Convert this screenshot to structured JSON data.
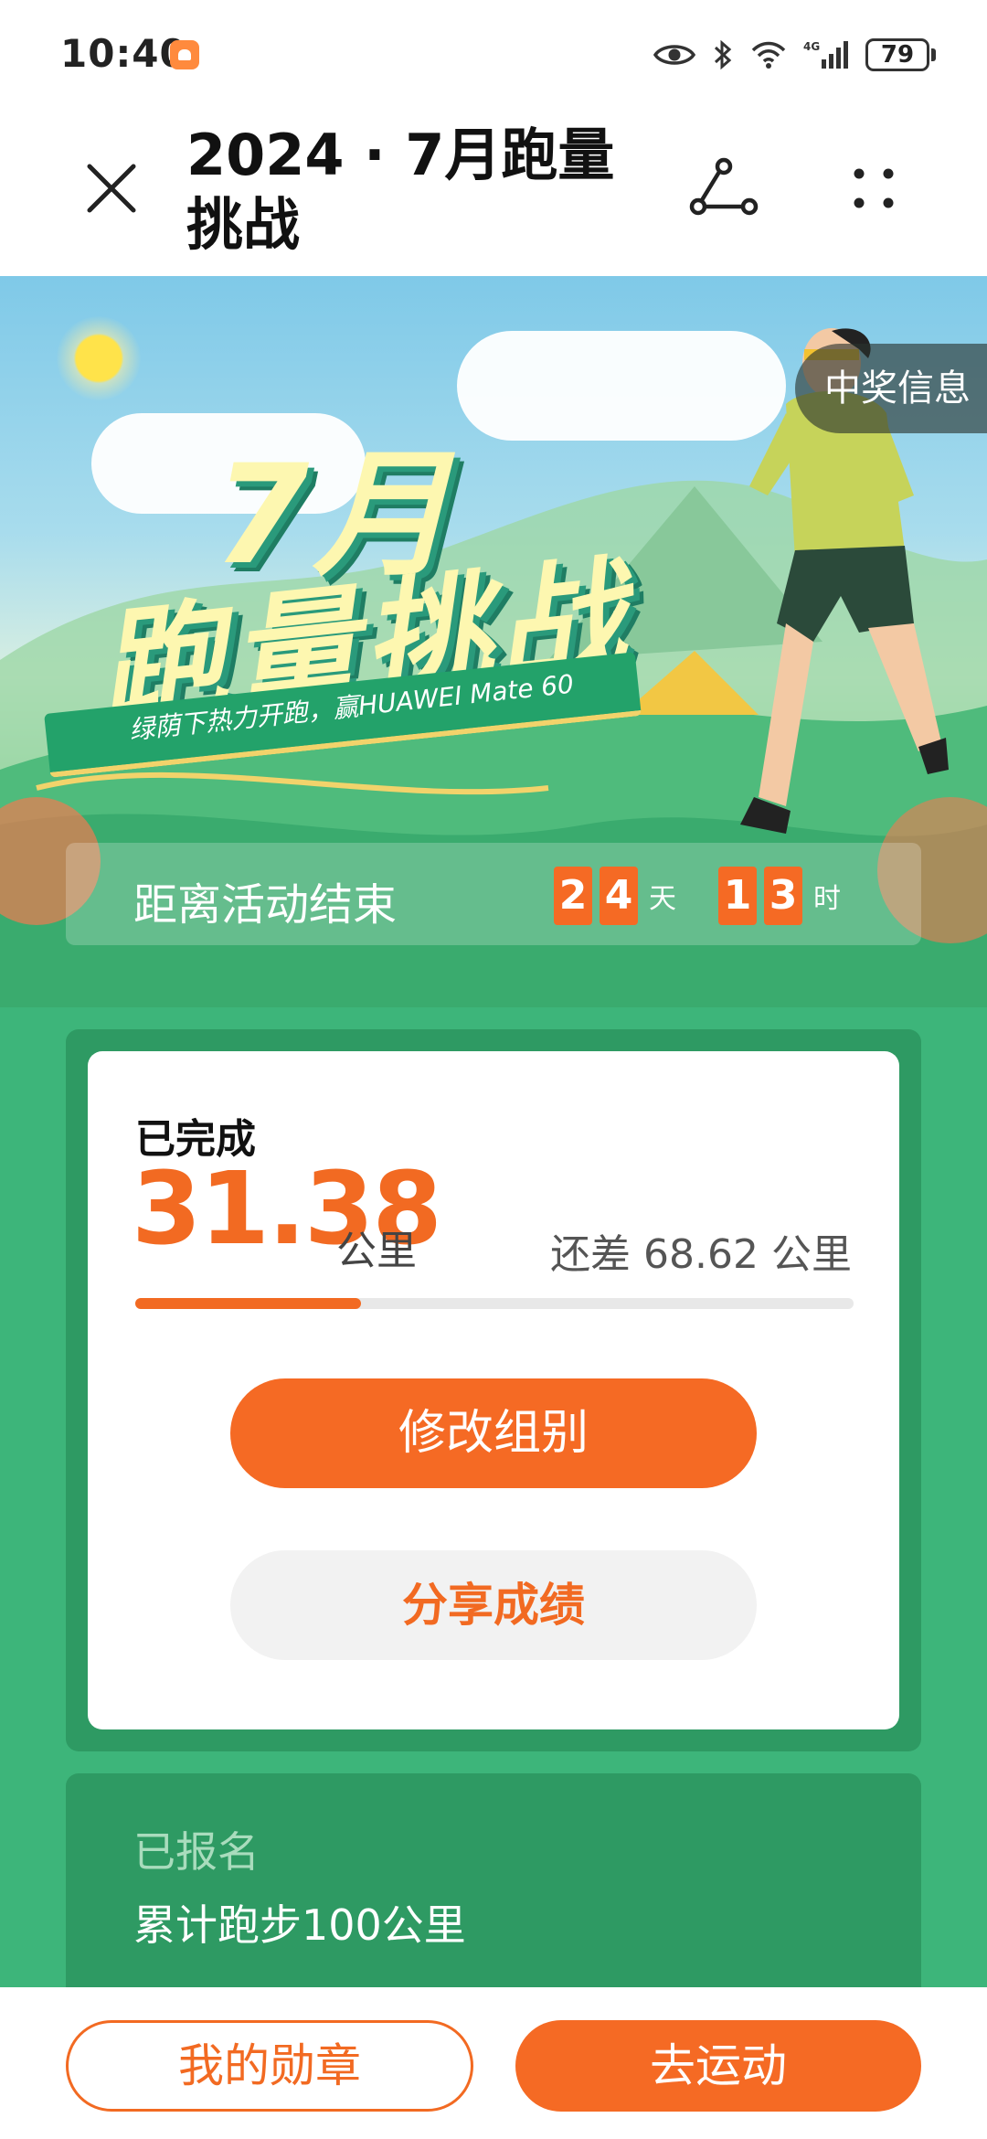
{
  "status_bar": {
    "time": "10:40",
    "battery": "79",
    "icons": [
      "app-icon",
      "eye-icon",
      "bluetooth-icon",
      "wifi-icon",
      "4g-signal-icon",
      "battery-icon"
    ]
  },
  "header": {
    "title": "2024 · 7月跑量挑战",
    "close_icon": "close-icon",
    "share_icon": "share-icon",
    "more_icon": "more-icon"
  },
  "banner": {
    "title_line1": "7月",
    "title_line2": "跑量挑战",
    "subtitle": "绿荫下热力开跑，赢HUAWEI Mate 60",
    "prize_info": "中奖信息",
    "countdown_label": "距离活动结束",
    "days": [
      "2",
      "4"
    ],
    "days_unit": "天",
    "hours": [
      "1",
      "3"
    ],
    "hours_unit": "时"
  },
  "progress": {
    "completed_label": "已完成",
    "distance": "31.38",
    "unit": "公里",
    "remaining_text": "还差 68.62 公里",
    "progress_fraction": 0.3138,
    "change_group_label": "修改组别",
    "share_label": "分享成绩"
  },
  "registration": {
    "label": "已报名",
    "detail": "累计跑步100公里"
  },
  "bottom": {
    "medals_label": "我的勋章",
    "go_label": "去运动"
  },
  "colors": {
    "accent": "#f56a24",
    "background_green": "#3db57a",
    "panel_green": "#2e9a63"
  }
}
